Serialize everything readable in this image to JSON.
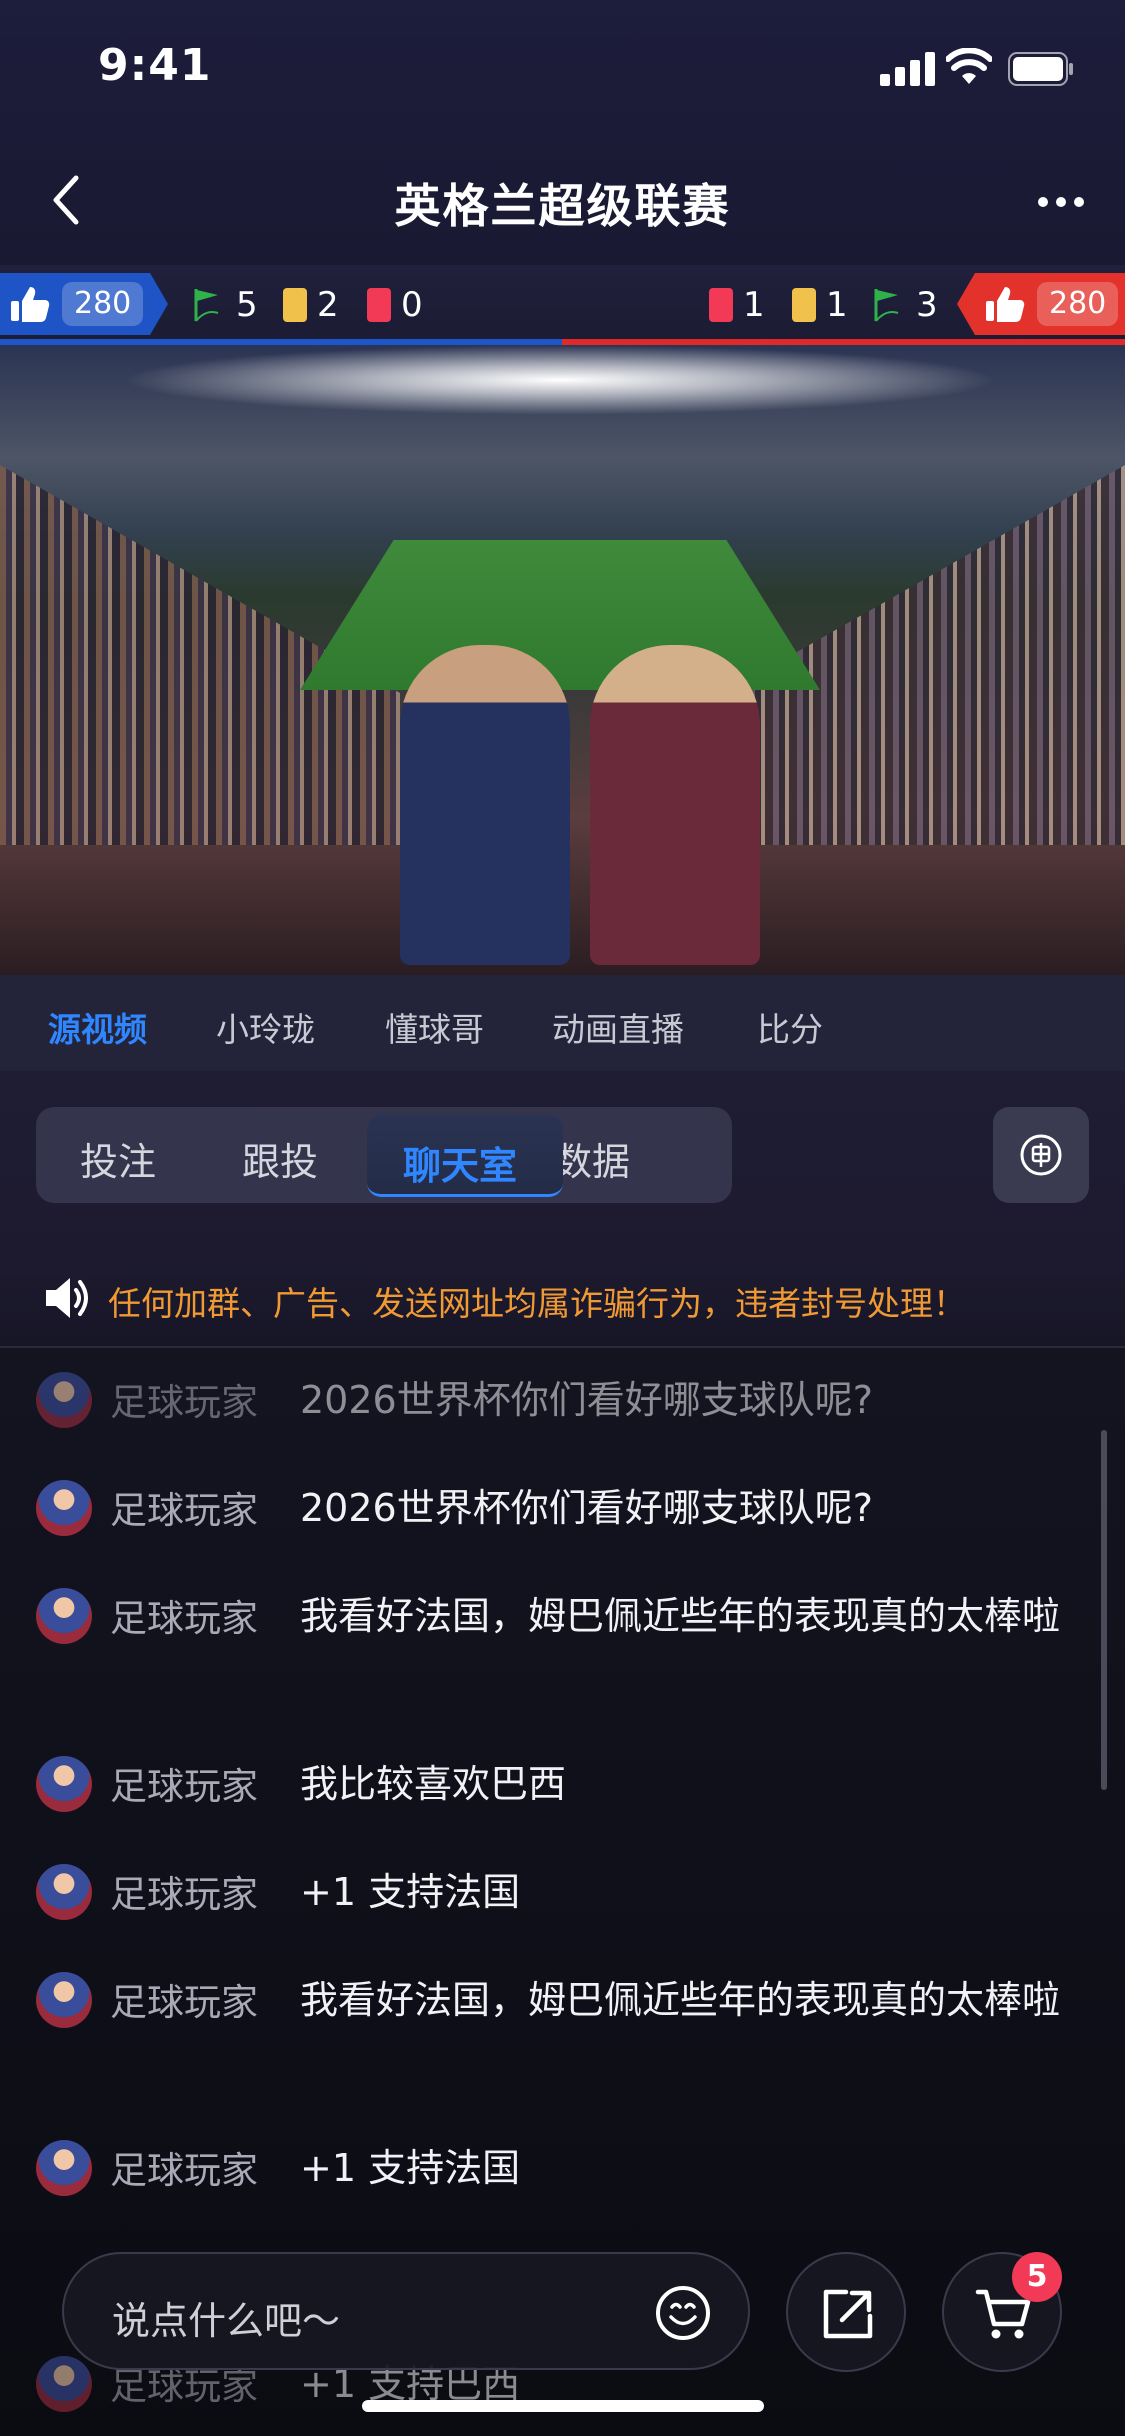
{
  "status_bar": {
    "time": "9:41"
  },
  "header": {
    "title": "英格兰超级联赛"
  },
  "match_stats": {
    "home": {
      "likes": "280",
      "corners": "5",
      "yellow": "2",
      "red": "0"
    },
    "away": {
      "likes": "280",
      "corners": "3",
      "yellow": "1",
      "red": "1"
    },
    "colors": {
      "home": "#1f54c6",
      "away": "#e3322c",
      "yellow_card": "#f0c14b",
      "red_card": "#f23a57",
      "corner_flag": "#2fb24a"
    }
  },
  "source_tabs": [
    {
      "label": "源视频",
      "active": true
    },
    {
      "label": "小玲珑"
    },
    {
      "label": "懂球哥"
    },
    {
      "label": "动画直播"
    },
    {
      "label": "比分"
    }
  ],
  "segments": [
    {
      "label": "投注"
    },
    {
      "label": "跟投"
    },
    {
      "label": "聊天室",
      "active": true
    },
    {
      "label": "数据"
    }
  ],
  "notice": "任何加群、广告、发送网址均属诈骗行为，违者封号处理！",
  "chat": [
    {
      "user": "足球玩家",
      "text": "2026世界杯你们看好哪支球队呢?"
    },
    {
      "user": "足球玩家",
      "text": "2026世界杯你们看好哪支球队呢?"
    },
    {
      "user": "足球玩家",
      "text": "我看好法国，姆巴佩近些年的表现真的太棒啦"
    },
    {
      "user": "足球玩家",
      "text": "我比较喜欢巴西"
    },
    {
      "user": "足球玩家",
      "text": "+1 支持法国"
    },
    {
      "user": "足球玩家",
      "text": "我看好法国，姆巴佩近些年的表现真的太棒啦"
    },
    {
      "user": "足球玩家",
      "text": "+1 支持法国"
    },
    {
      "user": "足球玩家",
      "text": "+1 支持巴西"
    }
  ],
  "input": {
    "placeholder": "说点什么吧～"
  },
  "cart_badge": "5",
  "accent": "#2f86ff",
  "notice_color": "#f19a34"
}
